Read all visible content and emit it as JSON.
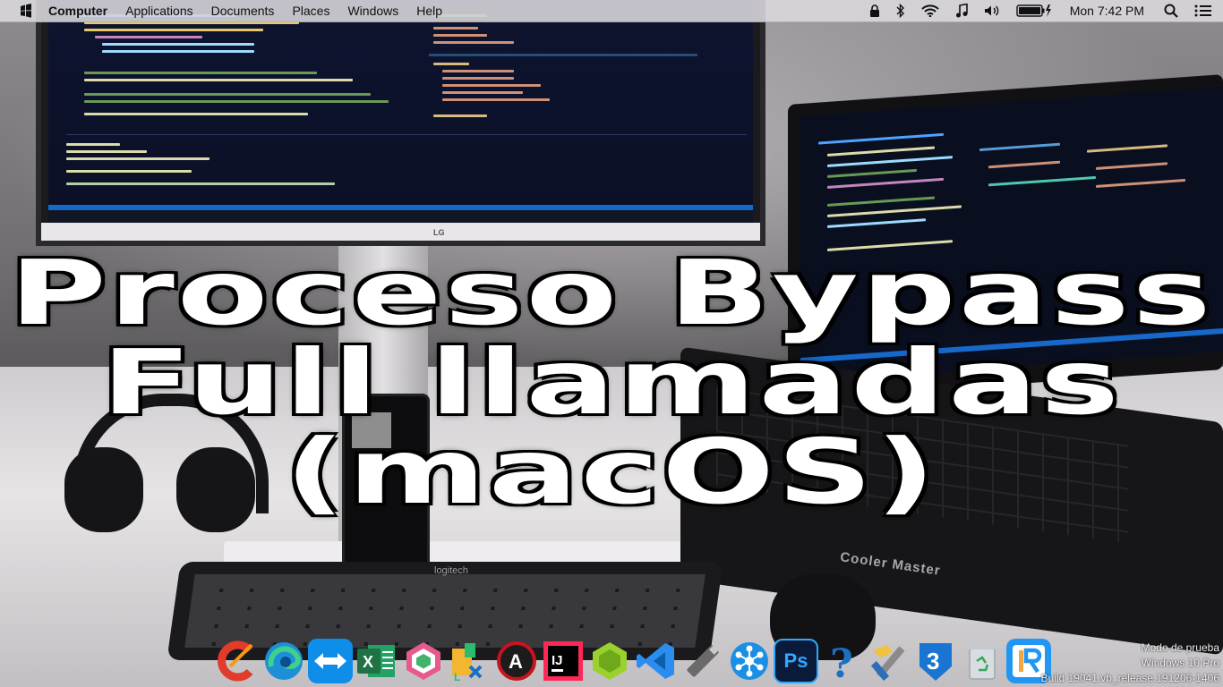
{
  "menubar": {
    "active_app": "Computer",
    "menus": [
      "Applications",
      "Documents",
      "Places",
      "Windows",
      "Help"
    ],
    "clock": "Mon 7:42 PM",
    "status_icons": [
      "lock-icon",
      "bluetooth-icon",
      "wifi-icon",
      "music-note-icon",
      "volume-icon",
      "battery-charging-icon",
      "search-icon",
      "list-menu-icon"
    ]
  },
  "headline": {
    "line1": "Proceso Bypass",
    "line2": "Full llamadas",
    "line3": "(macOS)"
  },
  "wallpaper": {
    "monitor_brand": "LG",
    "keyboard_brand": "logitech",
    "laptop_brand": "Cooler Master"
  },
  "dock": {
    "apps": [
      {
        "name": "ccleaner-icon",
        "color": "#e23b2b"
      },
      {
        "name": "edge-icon",
        "color": "#1d8fd8"
      },
      {
        "name": "teamviewer-icon",
        "color": "#0e8ee9"
      },
      {
        "name": "excel-icon",
        "color": "#1f7244"
      },
      {
        "name": "hexagon-app-icon",
        "color": "#e65a8c"
      },
      {
        "name": "folder-icon",
        "color": "#f2b632"
      },
      {
        "name": "aimp-icon",
        "color": "#c8141e"
      },
      {
        "name": "intellij-icon",
        "color": "#000000"
      },
      {
        "name": "android-studio-icon",
        "color": "#9bd12d"
      },
      {
        "name": "vscode-icon",
        "color": "#2a8ef0"
      },
      {
        "name": "usb-drive-icon",
        "color": "#6a6a6a"
      },
      {
        "name": "network-hub-icon",
        "color": "#1a8fe3"
      },
      {
        "name": "photoshop-icon",
        "color": "#0a1b3a"
      },
      {
        "name": "help-icon",
        "color": "#1d6fc2"
      },
      {
        "name": "xcode-tools-icon",
        "color": "#f1c23a"
      },
      {
        "name": "three-icon",
        "color": "#1a74d1"
      },
      {
        "name": "trash-icon",
        "color": "#d8dde2"
      },
      {
        "name": "rider-icon",
        "color": "#2196f3"
      }
    ]
  },
  "watermark": {
    "line1": "Modo de prueba",
    "line2": "Windows 10 Pro",
    "line3": "Build 19041.vb_release.191206-1406"
  }
}
